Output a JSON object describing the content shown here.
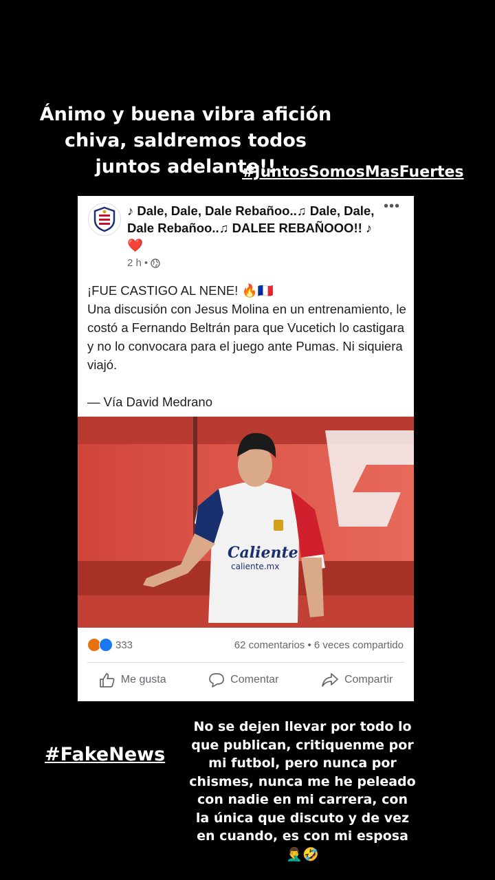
{
  "story": {
    "top_caption": "Ánimo y buena vibra afición chiva, saldremos todos juntos adelante!!",
    "hashtag_top": "#JuntosSomosMasFuertes",
    "hashtag_bottom": "#FakeNews",
    "bottom_caption": "No se dejen llevar por todo lo que publican, critiquenme por mi futbol, pero nunca por chismes, nunca me he peleado con nadie en mi carrera, con la única que discuto y de vez en cuando, es con mi esposa🤦‍♂️🤣"
  },
  "post": {
    "author": "♪ Dale, Dale, Dale Rebañoo..♫ Dale, Dale, Dale Rebañoo..♫ DALEE REBAÑOOO!! ♪ ❤️",
    "time": "2 h",
    "separator": "•",
    "more": "•••",
    "headline": "¡FUE CASTIGO AL NENE! 🔥🇫🇷",
    "body": "Una discusión con Jesus Molina en un entrenamiento, le costó a Fernando Beltrán para que Vucetich lo castigara y no lo convocara para el juego ante Pumas. Ni siquiera viajó.",
    "source": "— Vía David Medrano",
    "reaction_count": "333",
    "comments": "62 comentarios",
    "shares": "6 veces compartido",
    "stats_separator": "•",
    "actions": {
      "like": "Me gusta",
      "comment": "Comentar",
      "share": "Compartir"
    },
    "jersey_text": "Caliente",
    "jersey_sub": "caliente.mx"
  },
  "colors": {
    "background": "#000000",
    "card": "#ffffff",
    "fb_blue": "#1877f2",
    "muted": "#65676b",
    "photo_red": "#c94a3d"
  },
  "icons": [
    "club-crest-icon",
    "globe-icon",
    "more-options-icon",
    "angry-reaction-icon",
    "like-reaction-icon",
    "thumbs-up-icon",
    "comment-icon",
    "share-icon"
  ]
}
